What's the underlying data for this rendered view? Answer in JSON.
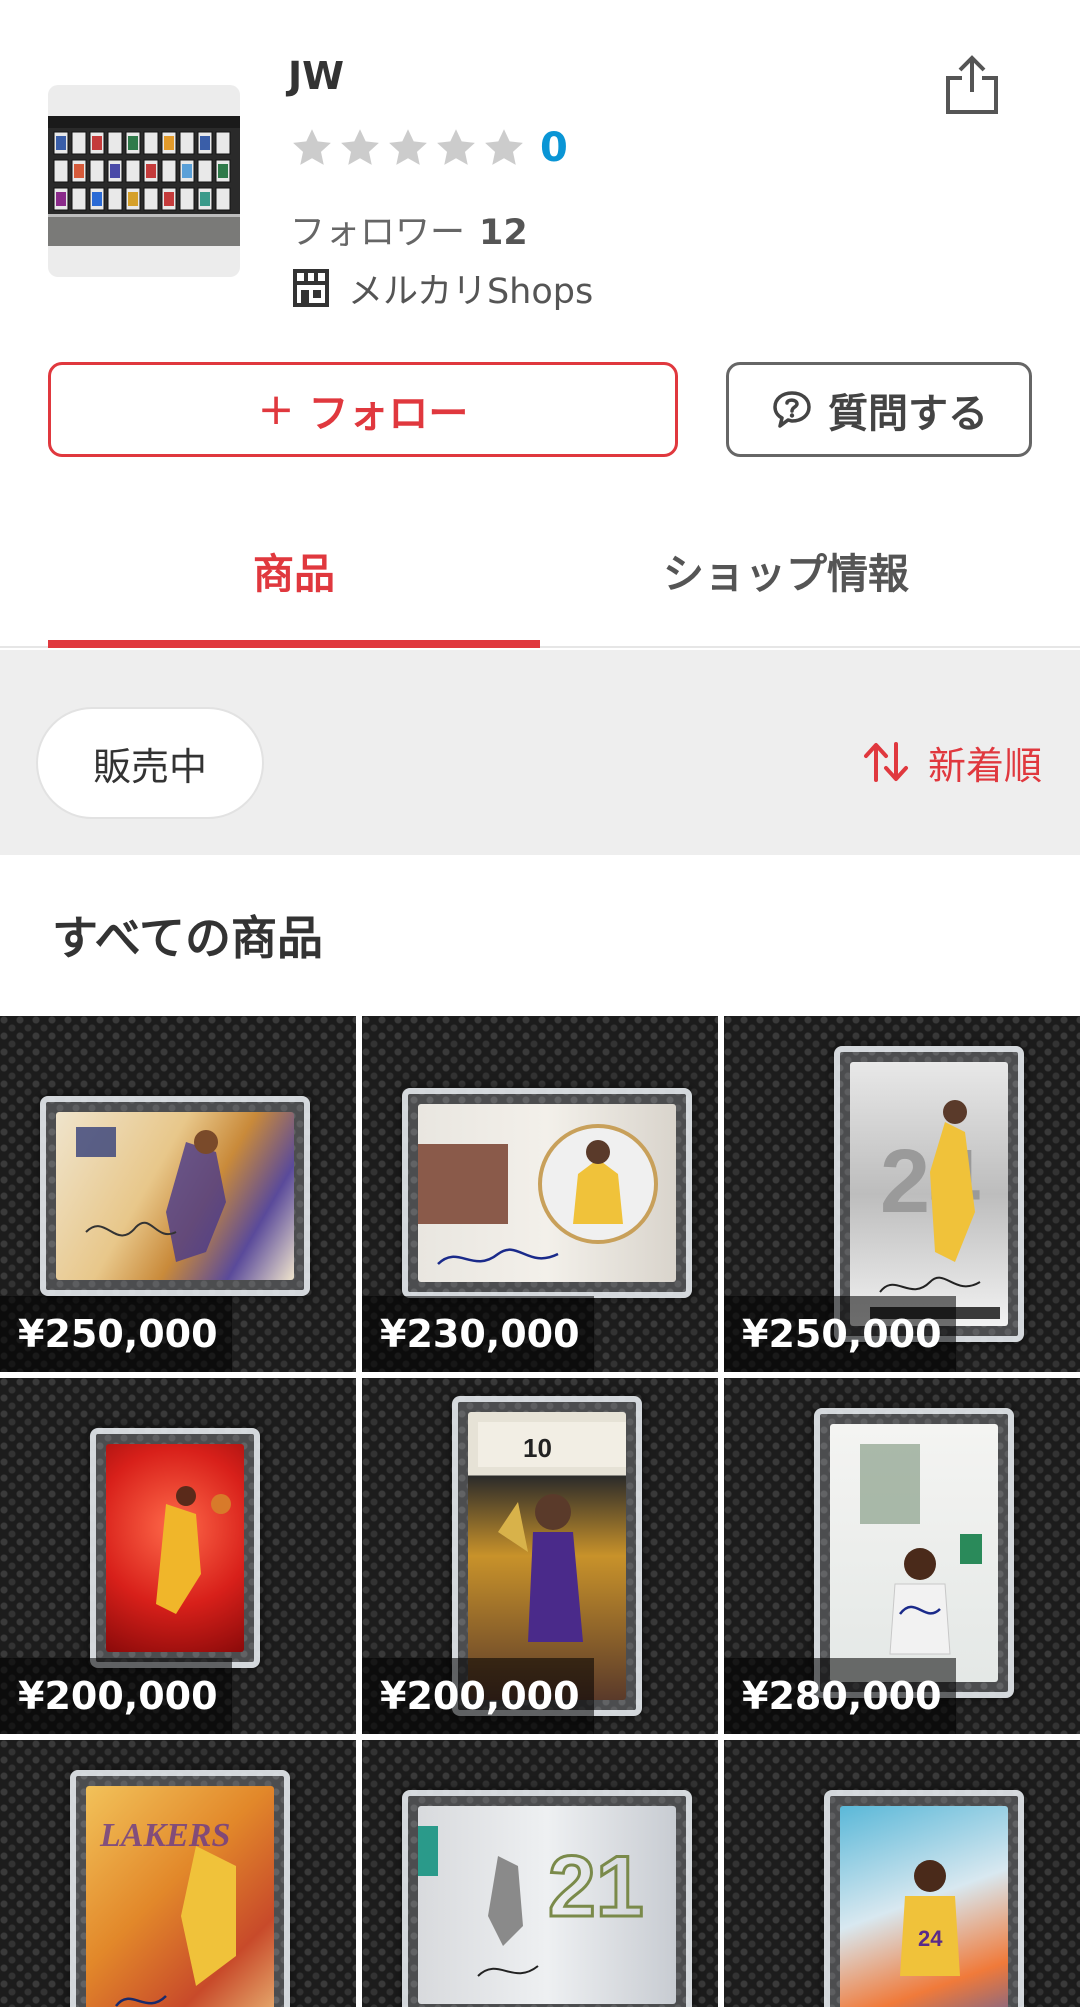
{
  "shop": {
    "name": "JW",
    "rating_count": "0",
    "followers_label": "フォロワー",
    "followers_count": "12",
    "shops_label": "メルカリShops"
  },
  "actions": {
    "follow_plus": "+",
    "follow_label": "フォロー",
    "ask_label": "質問する"
  },
  "tabs": [
    {
      "label": "商品",
      "active": true
    },
    {
      "label": "ショップ情報",
      "active": false
    }
  ],
  "filter": {
    "status_label": "販売中",
    "sort_label": "新着順"
  },
  "section_title": "すべての商品",
  "products": [
    {
      "price": "¥250,000"
    },
    {
      "price": "¥230,000"
    },
    {
      "price": "¥250,000"
    },
    {
      "price": "¥200,000"
    },
    {
      "price": "¥200,000"
    },
    {
      "price": "¥280,000"
    },
    {
      "price": ""
    },
    {
      "price": ""
    },
    {
      "price": ""
    }
  ],
  "colors": {
    "accent": "#e0383e",
    "rating_blue": "#0a95d5",
    "star_gray": "#cccccc",
    "filter_bg": "#eeeeee"
  },
  "icons": {
    "share": "share-icon",
    "star": "star-icon",
    "shops": "shop-icon",
    "ask": "chat-question-icon",
    "sort": "sort-arrows-icon"
  }
}
